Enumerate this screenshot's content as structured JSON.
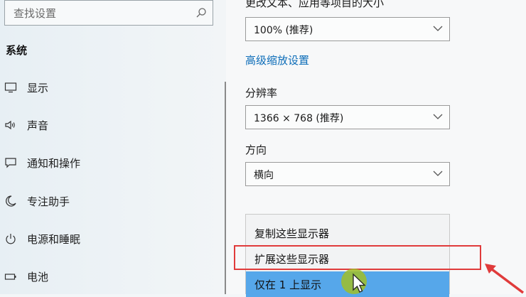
{
  "sidebar": {
    "search_placeholder": "查找设置",
    "section_title": "系统",
    "items": [
      {
        "label": "显示",
        "icon": "monitor-icon"
      },
      {
        "label": "声音",
        "icon": "speaker-icon"
      },
      {
        "label": "通知和操作",
        "icon": "message-icon"
      },
      {
        "label": "专注助手",
        "icon": "moon-icon"
      },
      {
        "label": "电源和睡眠",
        "icon": "power-icon"
      },
      {
        "label": "电池",
        "icon": "battery-icon"
      }
    ]
  },
  "main": {
    "scale_label": "更改文本、应用等项目的大小",
    "scale_value": "100% (推荐)",
    "advanced_scaling_link": "高级缩放设置",
    "resolution_label": "分辨率",
    "resolution_value": "1366 × 768 (推荐)",
    "orientation_label": "方向",
    "orientation_value": "横向",
    "multi_display_menu": [
      {
        "label": "复制这些显示器"
      },
      {
        "label": "扩展这些显示器"
      },
      {
        "label": "仅在 1 上显示"
      }
    ]
  },
  "colors": {
    "link": "#0b6cb8",
    "selected_item": "#56a7ea",
    "annotation_red": "#e03b3b"
  }
}
